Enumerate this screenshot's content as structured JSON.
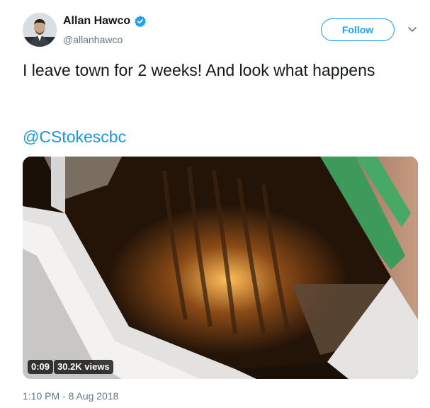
{
  "tweet": {
    "author": {
      "display_name": "Allan Hawco",
      "handle": "@allanhawco",
      "verified": true,
      "verified_icon": "verified-badge-icon"
    },
    "follow_label": "Follow",
    "caret_icon": "chevron-down-icon",
    "text": "I leave town for 2 weeks! And look what happens",
    "mention": "@CStokescbc",
    "video": {
      "duration": "0:09",
      "views": "30.2K views"
    },
    "timestamp": "1:10 PM - 8 Aug 2018"
  },
  "colors": {
    "accent": "#1da1f2",
    "link": "#1b95e0",
    "secondary_text": "#657786",
    "primary_text": "#14171a"
  }
}
